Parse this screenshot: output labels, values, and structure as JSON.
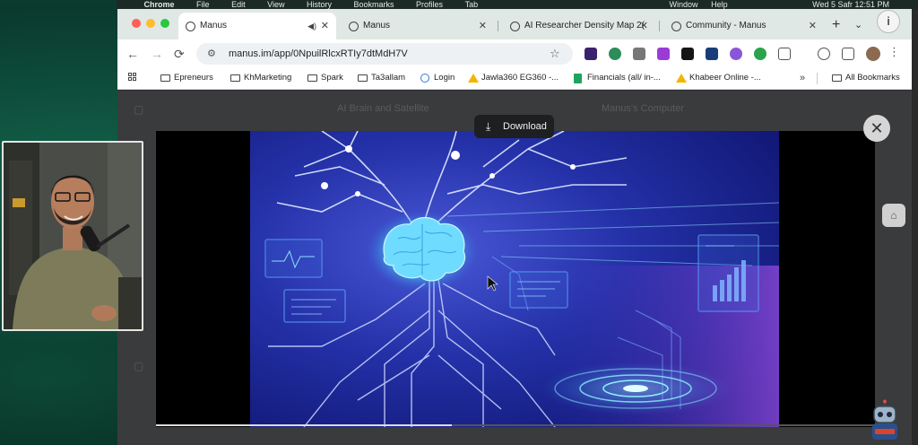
{
  "menubar": {
    "app": "Chrome",
    "items": [
      "File",
      "Edit",
      "View",
      "History",
      "Bookmarks",
      "Profiles",
      "Tab"
    ],
    "right_items": [
      "Window",
      "Help"
    ],
    "clock": "Wed 5 Safr  12:51 PM"
  },
  "tabs": [
    {
      "title": "Manus",
      "active": true
    },
    {
      "title": "Manus",
      "active": false
    },
    {
      "title": "AI Researcher Density Map 2(",
      "active": false
    },
    {
      "title": "Community - Manus",
      "active": false
    }
  ],
  "address_bar": {
    "url": "manus.im/app/0NpuilRlcxRTIy7dtMdH7V"
  },
  "bookmarks": [
    {
      "label": "Epreneurs",
      "icon": "folder-icon"
    },
    {
      "label": "KhMarketing",
      "icon": "folder-icon"
    },
    {
      "label": "Spark",
      "icon": "folder-icon"
    },
    {
      "label": "Ta3allam",
      "icon": "folder-icon"
    },
    {
      "label": "Login",
      "icon": "globe-icon"
    },
    {
      "label": "Jawla360 EG360 -...",
      "icon": "google-drive-icon"
    },
    {
      "label": "Financials (all/ in-...",
      "icon": "sheets-icon"
    },
    {
      "label": "Khabeer Online -...",
      "icon": "google-drive-icon"
    }
  ],
  "bookmarks_more": "»",
  "all_bookmarks": "All Bookmarks",
  "modal": {
    "download_label": "Download",
    "close_glyph": "✕"
  },
  "page_dim": {
    "header_left": "AI Brain and Satellite",
    "header_right": "Manus's Computer"
  },
  "colors": {
    "tab_bar": "#dfe8e4",
    "image_primary": "#1a2f9e",
    "image_glow": "#57d8ff",
    "accent_purple": "#8a47d6"
  },
  "icons": {
    "back": "←",
    "forward": "→",
    "reload": "⟳",
    "star": "☆",
    "new_tab": "+",
    "tab_menu": "⌄",
    "info": "i",
    "kebab": "⋮",
    "speaker": "◀)",
    "tab_close": "✕",
    "download": "⤓",
    "side_icon": "⌂"
  }
}
